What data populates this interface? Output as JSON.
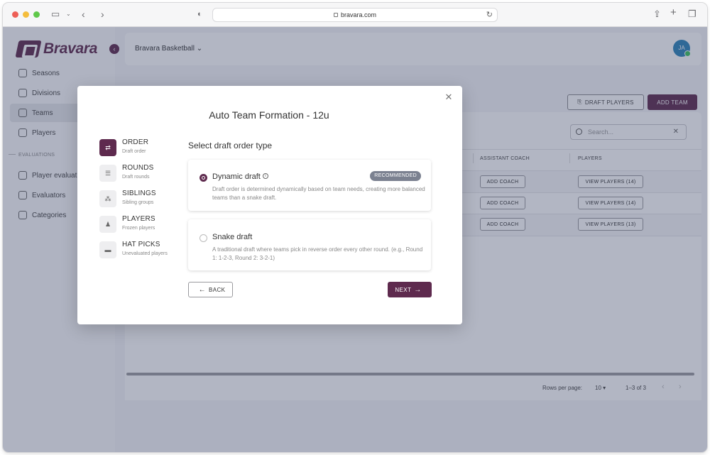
{
  "browser": {
    "url": "bravara.com"
  },
  "sidebar": {
    "logo_text": "Bravara",
    "items": [
      {
        "label": "Seasons"
      },
      {
        "label": "Divisions"
      },
      {
        "label": "Teams"
      },
      {
        "label": "Players"
      }
    ],
    "section_label": "EVALUATIONS",
    "eval_items": [
      {
        "label": "Player evaluati"
      },
      {
        "label": "Evaluators"
      },
      {
        "label": "Categories"
      }
    ]
  },
  "header": {
    "org_name": "Bravara Basketball",
    "avatar_initials": "JA"
  },
  "toolbar": {
    "draft_players_label": "DRAFT PLAYERS",
    "add_team_label": "ADD TEAM"
  },
  "table": {
    "search_placeholder": "Search...",
    "columns": [
      "ASSISTANT COACH",
      "PLAYERS"
    ],
    "rows": [
      {
        "assistant_coach": "ADD COACH",
        "players": "VIEW PLAYERS (14)"
      },
      {
        "assistant_coach": "ADD COACH",
        "players": "VIEW PLAYERS (14)"
      },
      {
        "assistant_coach": "ADD COACH",
        "players": "VIEW PLAYERS (13)"
      }
    ],
    "rows_per_page_label": "Rows per page:",
    "rows_per_page_value": "10",
    "range_label": "1–3 of 3"
  },
  "modal": {
    "title": "Auto Team Formation - 12u",
    "steps": [
      {
        "label": "ORDER",
        "sub": "Draft order"
      },
      {
        "label": "ROUNDS",
        "sub": "Draft rounds"
      },
      {
        "label": "SIBLINGS",
        "sub": "Sibling groups"
      },
      {
        "label": "PLAYERS",
        "sub": "Frozen players"
      },
      {
        "label": "HAT PICKS",
        "sub": "Unevaluated players"
      }
    ],
    "section_title": "Select draft order type",
    "options": [
      {
        "name": "Dynamic draft",
        "badge": "RECOMMENDED",
        "description": "Draft order is determined dynamically based on team needs, creating more balanced teams than a snake draft.",
        "selected": true
      },
      {
        "name": "Snake draft",
        "description": "A traditional draft where teams pick in reverse order every other round. (e.g., Round 1: 1-2-3, Round 2: 3-2-1)",
        "selected": false
      }
    ],
    "back_label": "BACK",
    "next_label": "NEXT"
  },
  "colors": {
    "brand": "#5e2a4e",
    "overlay": "#343e62"
  },
  "icons": [
    "sidebar-toggle-icon",
    "back-icon",
    "forward-icon",
    "shield-icon",
    "lock-icon",
    "reload-icon",
    "share-icon",
    "new-tab-icon",
    "tabs-icon",
    "close-icon",
    "info-icon",
    "arrow-left-icon",
    "arrow-right-icon",
    "search-icon"
  ]
}
